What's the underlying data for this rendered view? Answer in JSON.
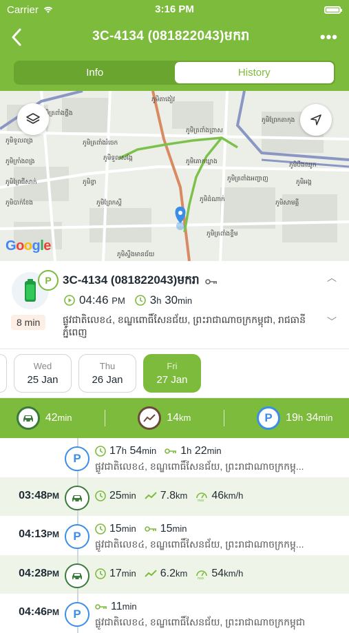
{
  "status": {
    "carrier": "Carrier",
    "time": "3:16 PM"
  },
  "header": {
    "title": "3C-4134 (081822043)មករា"
  },
  "tabs": [
    {
      "label": "Info"
    },
    {
      "label": "History"
    }
  ],
  "map": {
    "labels": [
      "ភូមិត្រពាំងថ្លឹង",
      "ភូមិតាងៀវ",
      "ភូមិព្រែកតាកុង",
      "ភូមិទួលពង្រ",
      "ភូមិត្រពាំងរំចេក",
      "ភូមិត្រពាំងព្រាស",
      "ភូមិក្រាំងពង្រ",
      "ភូមិទួលសង្កែ",
      "ភូមិគោកឃ្លាង",
      "ភូមិបឹងឈូក",
      "ភូមិព្រៃជីសាក់",
      "ភូមិខ្វា",
      "ភូមិត្រពាំងអញ្ចាញ",
      "ភូមិអង្គ",
      "ភូមិបាក់ខែង",
      "ភូមិព្រែកស្ដី",
      "ភូមិដំណាក់",
      "ភូមិសាមគ្គី",
      "ភូមិត្រពាំងខ្ទឹម",
      "ភូមិស្ទឹងមានជ័យ"
    ],
    "google_text": "Google"
  },
  "vehicle": {
    "plate": "3C-4134 (081822043)មករា",
    "parked_badge": "P",
    "duration_badge": "8 min",
    "start_time": "04:46",
    "start_ampm": "PM",
    "duration_h": "3",
    "duration_h_unit": "h",
    "duration_m": "30",
    "duration_m_unit": "min",
    "address": "ផ្លូវជាតិលេខ៤, ខណ្ឌពោធិ៍សែនជ័យ, ព្រះរាជាណាចក្រកម្ពុជា, រាជធានីភ្នំពេញ"
  },
  "dates": [
    {
      "dow": "Wed",
      "date": "25 Jan"
    },
    {
      "dow": "Thu",
      "date": "26 Jan"
    },
    {
      "dow": "Fri",
      "date": "27 Jan"
    }
  ],
  "summary": {
    "drive": "42",
    "drive_unit": "min",
    "distance": "14",
    "distance_unit": "km",
    "park_h": "19",
    "park_h_unit": "h",
    "park_m": "34",
    "park_m_unit": "min"
  },
  "rows": [
    {
      "time": "",
      "ampm": "",
      "type": "P",
      "a": "17",
      "a_u": "h",
      "a2": "54",
      "a2_u": "min",
      "b": "1",
      "b_u": "h",
      "b2": "22",
      "b2_u": "min",
      "addr": "ផ្លូវជាតិលេខ៤, ខណ្ឌពោធិ៍សែនជ័យ, ព្រះរាជាណាចក្រកម្ពុ..."
    },
    {
      "time": "03:48",
      "ampm": "PM",
      "type": "drive",
      "a": "25",
      "a_u": "min",
      "b": "7.8",
      "b_u": "km",
      "c": "46",
      "c_u": "km/h",
      "c_tag": "max"
    },
    {
      "time": "04:13",
      "ampm": "PM",
      "type": "P",
      "a": "15",
      "a_u": "min",
      "b": "15",
      "b_u": "min",
      "addr": "ផ្លូវជាតិលេខ៤, ខណ្ឌពោធិ៍សែនជ័យ, ព្រះរាជាណាចក្រកម្ពុ..."
    },
    {
      "time": "04:28",
      "ampm": "PM",
      "type": "drive",
      "a": "17",
      "a_u": "min",
      "b": "6.2",
      "b_u": "km",
      "c": "54",
      "c_u": "km/h",
      "c_tag": "max"
    },
    {
      "time": "04:46",
      "ampm": "PM",
      "type": "P",
      "b": "11",
      "b_u": "min",
      "addr": "ផ្លូវជាតិលេខ៤, ខណ្ឌពោធិ៍សែនជ័យ, ព្រះរាជាណាចក្រកម្ពុជា"
    }
  ],
  "colors": {
    "brand_green": "#7cbb3b",
    "park_blue": "#3b8ee8",
    "drive_green": "#3c7a3b",
    "route_green": "#7cc24a",
    "orange_road": "#d98a62"
  }
}
